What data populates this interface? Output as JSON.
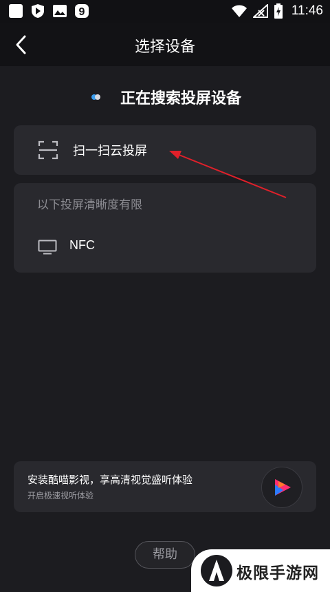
{
  "status_bar": {
    "time": "11:46",
    "left_icons": [
      "square-app-icon",
      "shield-play-icon",
      "image-icon",
      "nine-badge-icon"
    ],
    "right_icons": [
      "wifi-icon",
      "no-signal-icon",
      "battery-charging-icon"
    ]
  },
  "header": {
    "title": "选择设备",
    "back_icon": "chevron-left-icon"
  },
  "searching": {
    "text": "正在搜索投屏设备"
  },
  "scan_card": {
    "label": "扫一扫云投屏",
    "icon": "scan-icon"
  },
  "devices_card": {
    "header": "以下投屏清晰度有限",
    "devices": [
      {
        "name": "NFC",
        "icon": "tv-icon"
      }
    ]
  },
  "annotation": {
    "arrow_color": "#e0202a"
  },
  "promo": {
    "title": "安装酷喵影视，享高清视觉盛听体验",
    "subtitle": "开启极速视听体验",
    "logo_icon": "play-logo-icon"
  },
  "help_button": {
    "label": "帮助"
  },
  "watermark": {
    "text": "极限手游网"
  }
}
